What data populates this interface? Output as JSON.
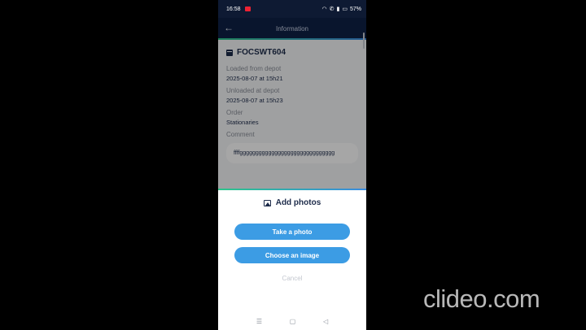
{
  "status_bar": {
    "time": "16:58",
    "battery": "57%",
    "indicators": [
      "wifi-icon",
      "call-icon",
      "signal-icon",
      "battery-icon"
    ]
  },
  "app_bar": {
    "title": "Information",
    "back_icon": "arrow-left-icon"
  },
  "detail": {
    "id": "FOCSWT604",
    "fields": [
      {
        "label": "Loaded from depot",
        "value": "2025-08-07 at 15h21"
      },
      {
        "label": "Unloaded at depot",
        "value": "2025-08-07 at 15h23"
      },
      {
        "label": "Order",
        "value": "Stationaries"
      },
      {
        "label": "Comment",
        "value": ""
      }
    ],
    "comment_text": "ffffgggggggggggggggggggggggggggggg"
  },
  "sheet": {
    "title": "Add photos",
    "take_photo": "Take a photo",
    "choose_image": "Choose an image",
    "cancel": "Cancel"
  },
  "nav": {
    "menu": "☰",
    "home": "▢",
    "back": "◁"
  },
  "watermark": "clideo.com",
  "colors": {
    "app_bar": "#0f2146",
    "button": "#3c9ce4",
    "accent_start": "#2cc58a",
    "accent_end": "#3a8be0"
  }
}
